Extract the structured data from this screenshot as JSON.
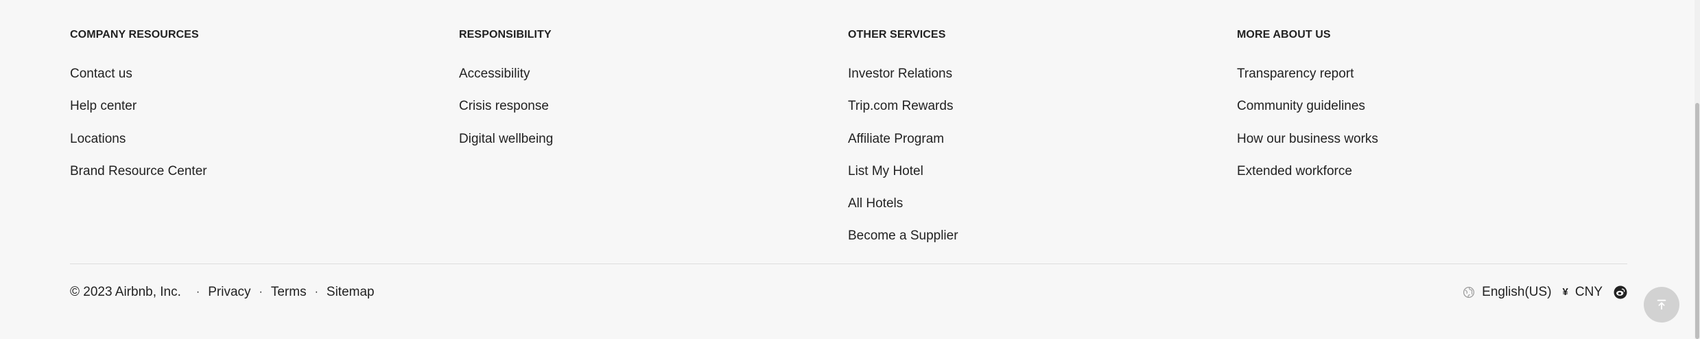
{
  "columns": [
    {
      "heading": "COMPANY RESOURCES",
      "links": [
        "Contact us",
        "Help center",
        "Locations",
        "Brand Resource Center"
      ]
    },
    {
      "heading": "RESPONSIBILITY",
      "links": [
        "Accessibility",
        "Crisis response",
        "Digital wellbeing"
      ]
    },
    {
      "heading": "OTHER SERVICES",
      "links": [
        "Investor Relations",
        "Trip.com Rewards",
        "Affiliate Program",
        "List My Hotel",
        "All Hotels",
        "Become a Supplier"
      ]
    },
    {
      "heading": "MORE ABOUT US",
      "links": [
        "Transparency report",
        "Community guidelines",
        "How our business works",
        "Extended workforce"
      ]
    }
  ],
  "legal": {
    "copyright": "© 2023 Airbnb, Inc.",
    "separator": "·",
    "privacy": "Privacy",
    "terms": "Terms",
    "sitemap": "Sitemap"
  },
  "prefs": {
    "language": "English(US)",
    "currency_symbol": "¥",
    "currency": "CNY",
    "icons": [
      "globe-icon",
      "weibo-icon",
      "back-to-top-icon"
    ]
  }
}
